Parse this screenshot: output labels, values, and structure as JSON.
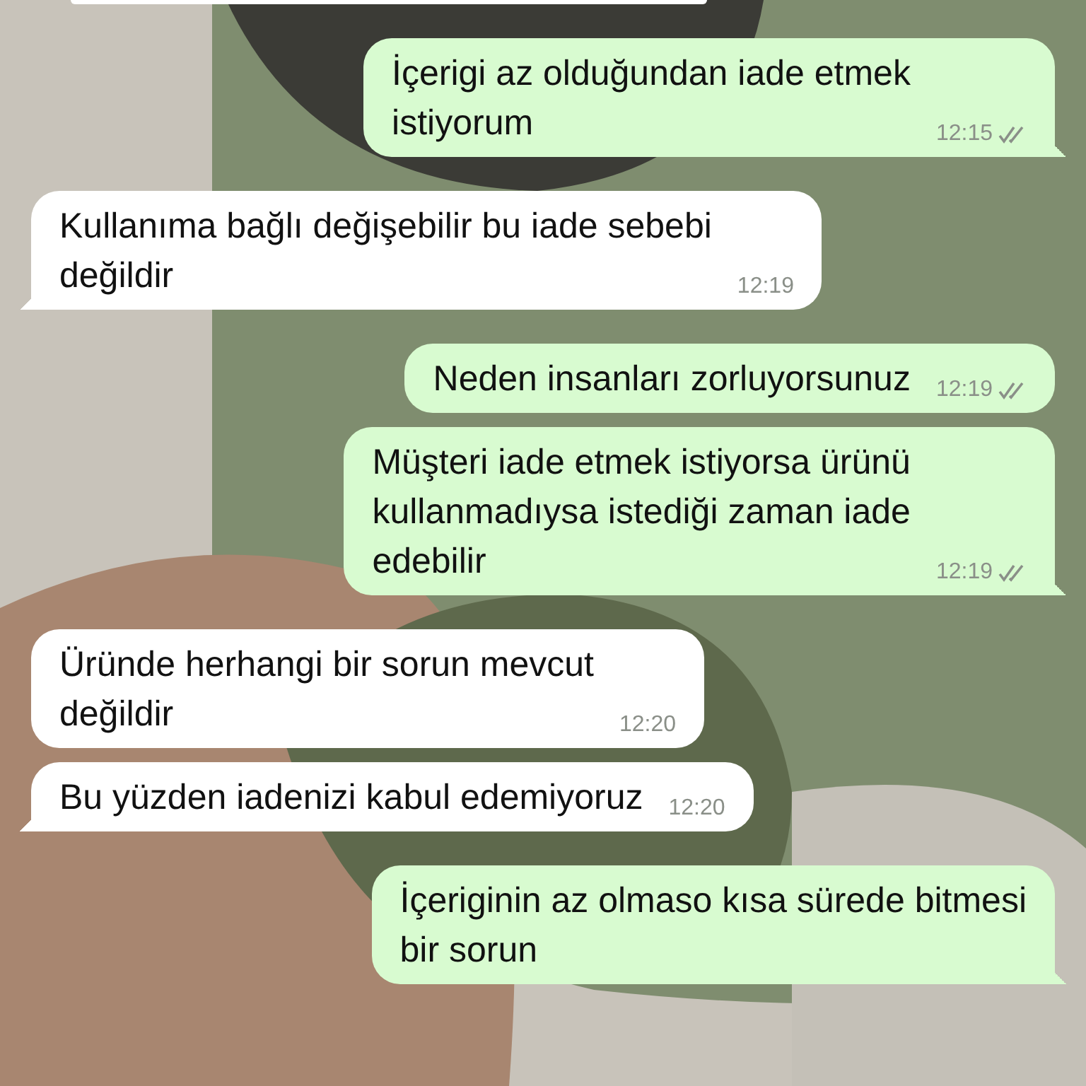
{
  "messages": [
    {
      "kind": "partial"
    },
    {
      "kind": "outgoing",
      "text": "İçerigi az olduğundan iade etmek\nistiyorum",
      "time": "12:15",
      "read": false
    },
    {
      "kind": "incoming",
      "text": "Kullanıma bağlı değişebilir bu iade sebebi\ndeğildir",
      "time": "12:19"
    },
    {
      "kind": "outgoing",
      "text": "Neden insanları zorluyorsunuz",
      "time": "12:19",
      "read": false
    },
    {
      "kind": "outgoing",
      "text": "Müşteri iade etmek istiyorsa ürünü\nkullanmadıysa istediği zaman iade\nedebilir",
      "time": "12:19",
      "read": false
    },
    {
      "kind": "incoming",
      "text": "Üründe herhangi bir sorun mevcut\ndeğildir",
      "time": "12:20"
    },
    {
      "kind": "incoming",
      "text": "Bu yüzden iadenizi kabul edemiyoruz",
      "time": "12:20"
    },
    {
      "kind": "outgoing",
      "text": "İçeriginin az olmaso kısa sürede bitmesi\nbir sorun"
    }
  ]
}
